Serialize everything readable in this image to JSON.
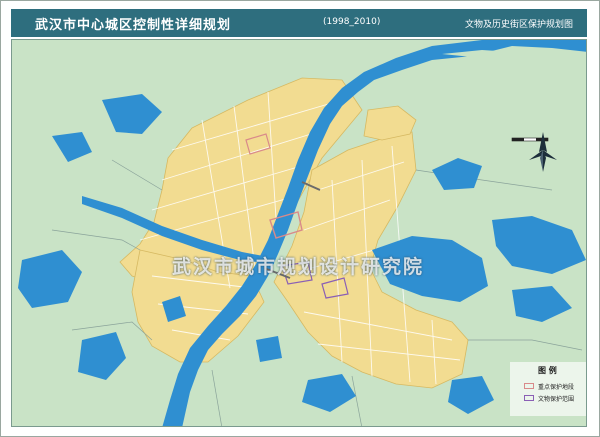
{
  "header": {
    "title": "武汉市中心城区控制性详细规划",
    "years": "(1998_2010)",
    "subtitle": "文物及历史街区保护规划图"
  },
  "map": {
    "watermark": "武汉市城市规划设计研究院",
    "colors": {
      "land": "#c9e3c6",
      "water": "#2f8fd1",
      "urban": "#f2dc91",
      "road": "#ffffff",
      "header_bg": "#2e6e7e"
    },
    "icons": [
      "compass-rose-icon",
      "scale-bar-icon"
    ]
  },
  "legend": {
    "title": "图 例",
    "items": [
      {
        "label": "重点保护地段",
        "color": "#d98a8a"
      },
      {
        "label": "文物保护范围",
        "color": "#8a5fb5"
      }
    ]
  }
}
